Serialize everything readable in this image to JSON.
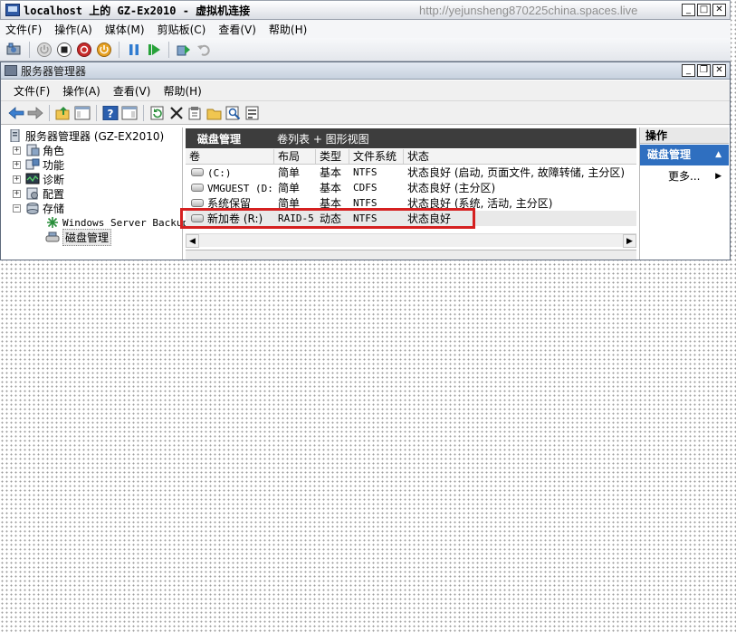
{
  "vm_window": {
    "title": "localhost 上的 GZ-Ex2010 - 虚拟机连接",
    "watermark": "http://yejunsheng870225china.spaces.live",
    "menu": [
      "文件(F)",
      "操作(A)",
      "媒体(M)",
      "剪贴板(C)",
      "查看(V)",
      "帮助(H)"
    ],
    "toolbar_icons": [
      "ctrl-alt-del-icon",
      "start-icon",
      "turn-off-icon",
      "shutdown-icon",
      "save-state-icon",
      "pause-icon",
      "resume-icon",
      "snapshot-icon",
      "revert-icon"
    ]
  },
  "server_manager": {
    "title": "服务器管理器",
    "menu": [
      "文件(F)",
      "操作(A)",
      "查看(V)",
      "帮助(H)"
    ],
    "toolbar_icons": [
      "back-icon",
      "forward-icon",
      "up-icon",
      "show-hide-tree-icon",
      "help-icon",
      "show-hide-action-icon",
      "refresh-icon",
      "delete-icon",
      "properties-icon",
      "open-icon",
      "search-icon",
      "export-icon"
    ]
  },
  "tree": {
    "root": "服务器管理器 (GZ-EX2010)",
    "items": [
      {
        "label": "角色",
        "expander": "+"
      },
      {
        "label": "功能",
        "expander": "+"
      },
      {
        "label": "诊断",
        "expander": "+"
      },
      {
        "label": "配置",
        "expander": "+"
      },
      {
        "label": "存储",
        "expander": "−"
      }
    ],
    "children": [
      {
        "label": "Windows Server Backup"
      },
      {
        "label": "磁盘管理"
      }
    ]
  },
  "content": {
    "title": "磁盘管理",
    "subtitle": "卷列表 + 图形视图",
    "columns": [
      "卷",
      "布局",
      "类型",
      "文件系统",
      "状态"
    ],
    "rows": [
      {
        "volume": "(C:)",
        "layout": "简单",
        "type": "基本",
        "fs": "NTFS",
        "status": "状态良好 (启动, 页面文件, 故障转储, 主分区)"
      },
      {
        "volume": "VMGUEST (D:)",
        "layout": "简单",
        "type": "基本",
        "fs": "CDFS",
        "status": "状态良好 (主分区)"
      },
      {
        "volume": "系统保留",
        "layout": "简单",
        "type": "基本",
        "fs": "NTFS",
        "status": "状态良好 (系统, 活动, 主分区)"
      },
      {
        "volume": "新加卷 (R:)",
        "layout": "RAID-5",
        "type": "动态",
        "fs": "NTFS",
        "status": "状态良好"
      }
    ],
    "highlight_color": "#d52020"
  },
  "actions": {
    "header": "操作",
    "section": "磁盘管理",
    "more": "更多..."
  }
}
